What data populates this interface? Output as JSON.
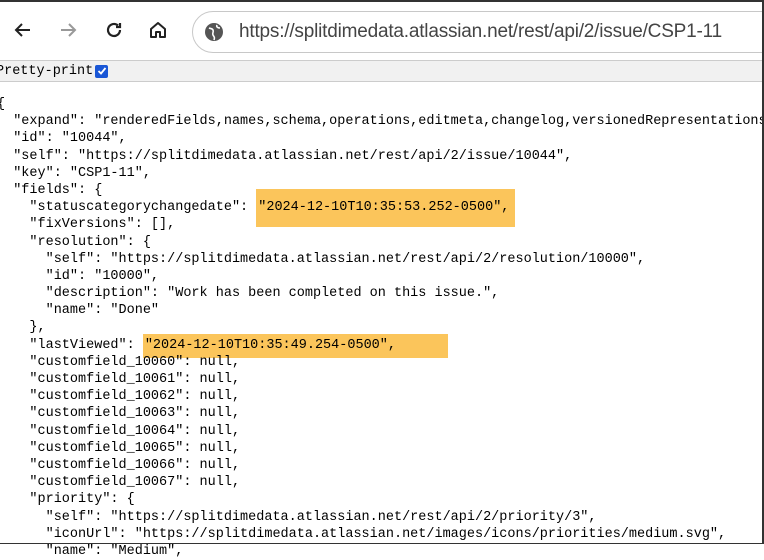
{
  "browser": {
    "url": "https://splitdimedata.atlassian.net/rest/api/2/issue/CSP1-11",
    "icons": [
      "back-icon",
      "forward-icon",
      "reload-icon",
      "home-icon",
      "globe-icon"
    ]
  },
  "pretty_print": {
    "label": "Pretty-print",
    "checked": true
  },
  "highlight_color": "#fbc55b",
  "json_lines": [
    {
      "indent": "",
      "text": "{",
      "hl": ""
    },
    {
      "indent": "  ",
      "text": "\"expand\": \"renderedFields,names,schema,operations,editmeta,changelog,versionedRepresentations,",
      "hl": ""
    },
    {
      "indent": "  ",
      "text": "\"id\": \"10044\",",
      "hl": ""
    },
    {
      "indent": "  ",
      "text": "\"self\": \"https://splitdimedata.atlassian.net/rest/api/2/issue/10044\",",
      "hl": ""
    },
    {
      "indent": "  ",
      "text": "\"key\": \"CSP1-11\",",
      "hl": ""
    },
    {
      "indent": "  ",
      "text": "\"fields\": {",
      "hl": ""
    },
    {
      "indent": "    ",
      "text": "\"statuscategorychangedate\": ",
      "hl": "\"2024-12-10T10:35:53.252-0500\","
    },
    {
      "indent": "    ",
      "text": "\"fixVersions\": [],",
      "hl": ""
    },
    {
      "indent": "    ",
      "text": "\"resolution\": {",
      "hl": ""
    },
    {
      "indent": "      ",
      "text": "\"self\": \"https://splitdimedata.atlassian.net/rest/api/2/resolution/10000\",",
      "hl": ""
    },
    {
      "indent": "      ",
      "text": "\"id\": \"10000\",",
      "hl": ""
    },
    {
      "indent": "      ",
      "text": "\"description\": \"Work has been completed on this issue.\",",
      "hl": ""
    },
    {
      "indent": "      ",
      "text": "\"name\": \"Done\"",
      "hl": ""
    },
    {
      "indent": "    ",
      "text": "},",
      "hl": ""
    },
    {
      "indent": "    ",
      "text": "\"lastViewed\": ",
      "hl": "\"2024-12-10T10:35:49.254-0500\","
    },
    {
      "indent": "    ",
      "text": "\"customfield_10060\": null,",
      "hl": ""
    },
    {
      "indent": "    ",
      "text": "\"customfield_10061\": null,",
      "hl": ""
    },
    {
      "indent": "    ",
      "text": "\"customfield_10062\": null,",
      "hl": ""
    },
    {
      "indent": "    ",
      "text": "\"customfield_10063\": null,",
      "hl": ""
    },
    {
      "indent": "    ",
      "text": "\"customfield_10064\": null,",
      "hl": ""
    },
    {
      "indent": "    ",
      "text": "\"customfield_10065\": null,",
      "hl": ""
    },
    {
      "indent": "    ",
      "text": "\"customfield_10066\": null,",
      "hl": ""
    },
    {
      "indent": "    ",
      "text": "\"customfield_10067\": null,",
      "hl": ""
    },
    {
      "indent": "    ",
      "text": "\"priority\": {",
      "hl": ""
    },
    {
      "indent": "      ",
      "text": "\"self\": \"https://splitdimedata.atlassian.net/rest/api/2/priority/3\",",
      "hl": ""
    },
    {
      "indent": "      ",
      "text": "\"iconUrl\": \"https://splitdimedata.atlassian.net/images/icons/priorities/medium.svg\",",
      "hl": ""
    },
    {
      "indent": "      ",
      "text": "\"name\": \"Medium\",",
      "hl": ""
    }
  ]
}
